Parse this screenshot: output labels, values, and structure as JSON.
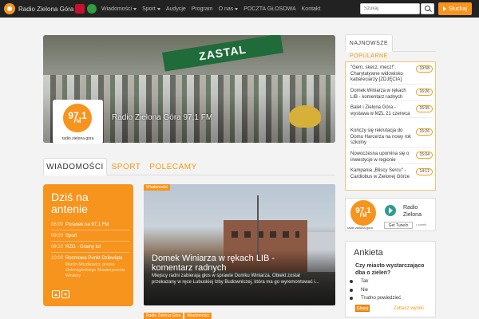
{
  "topbar": {
    "brand_title": "Radio Zielona Góra",
    "nav": [
      {
        "label": "Wiadomości",
        "dropdown": true
      },
      {
        "label": "Sport",
        "dropdown": true
      },
      {
        "label": "Audycje",
        "dropdown": false
      },
      {
        "label": "Program",
        "dropdown": false
      },
      {
        "label": "O nas",
        "dropdown": true
      },
      {
        "label": "POCZTA GŁOSOWA",
        "dropdown": false
      },
      {
        "label": "Kontakt",
        "dropdown": false
      }
    ],
    "search_placeholder": "Szukaj",
    "listen_label": "Słuchaj"
  },
  "hero": {
    "banner_text": "ZASTAL",
    "caption": "Radio Zielona Góra 97,1 FM",
    "logo_freq": "97,1",
    "logo_fm": "FM",
    "logo_sub": "radio zielona gora"
  },
  "tabs": [
    "WIADOMOŚCI",
    "SPORT",
    "POLECAMY"
  ],
  "onair": {
    "title_line1": "Dziś na",
    "title_line2": "antenie",
    "items": [
      {
        "time": "06:00",
        "title": "Poranek na 97,1 FM",
        "sub": ""
      },
      {
        "time": "09:00",
        "title": "Sport",
        "sub": ""
      },
      {
        "time": "09:10",
        "title": "RZG - Gramy to!",
        "sub": ""
      },
      {
        "time": "10:00",
        "title": "Rozmowa Punkt Dziewiąta",
        "sub": "Marcin Mozdkowicz, prezes Zielonogórskiego Stowarzyszenia Winiarzy"
      }
    ]
  },
  "news": {
    "tag": "Wiadomości",
    "title": "Domek Winiarza w rękach LIB - komentarz radnych",
    "lead": "Miejscy radni zabierają głos w sprawie Domku Winiarza. Obiekt został przekazany w ręce Lubuskiej Izby Budowniczej, która ma go wyremontować i...",
    "bottom_tags": [
      "Radio Zielona Góra",
      "Wiadomości"
    ]
  },
  "right": {
    "tab_label": "NAJNOWSZE",
    "popular_label": "POPULARNE",
    "popular": [
      {
        "text": "\"Gem, skecz, mecz!\". Charytatywne widowisko kabareciarzy [ZDJĘCIA]",
        "time": "19:58"
      },
      {
        "text": "Domek Winiarza w rękach LIB - komentarz radnych",
        "time": "16:26"
      },
      {
        "text": "Balet i Zielona Góra - wystawa w MZL 21 czerwca",
        "time": "15:55"
      },
      {
        "text": "Kończy się rekrutacja do Domu Harcerza na nowy rok szkolny",
        "time": "15:26"
      },
      {
        "text": "Nowoczesna upomina się o inwestycje w regionie",
        "time": "15:04"
      },
      {
        "text": "Kampania „Bliscy Sercu\" - Cardiobus w Zielonej Górze",
        "time": "14:12"
      }
    ],
    "player": {
      "logo_freq": "97,1",
      "logo_fm": "FM",
      "logo_sub": "radio zielona gora",
      "name": "Radio Zielona",
      "tunein": "Get TuneIn",
      "tunein_count": "• tunein"
    },
    "poll": {
      "title": "Ankieta",
      "question": "Czy miasto wystarczająco dba o zieleń?",
      "options": [
        "Tak",
        "Nie",
        "Trudno powiedzieć"
      ],
      "vote_label": "Głosuj",
      "results_label": "Zobacz wyniki"
    }
  }
}
